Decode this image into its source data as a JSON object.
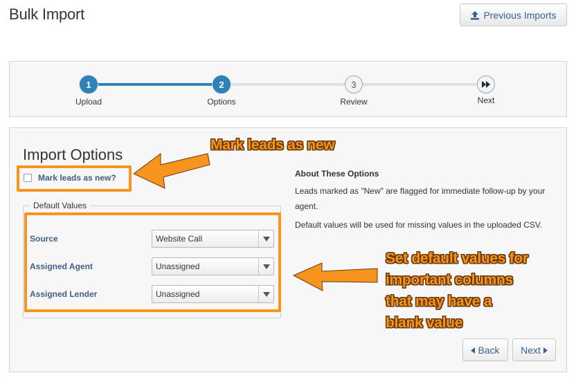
{
  "header": {
    "title": "Bulk Import",
    "previous_imports_label": "Previous Imports",
    "previous_imports_icon": "upload-icon"
  },
  "wizard": {
    "steps": [
      {
        "number": "1",
        "label": "Upload",
        "state": "complete"
      },
      {
        "number": "2",
        "label": "Options",
        "state": "current"
      },
      {
        "number": "3",
        "label": "Review",
        "state": "upcoming"
      },
      {
        "number": "",
        "label": "Next",
        "state": "upcoming",
        "icon": "fast-forward-icon"
      }
    ]
  },
  "options": {
    "title": "Import Options",
    "mark_new_label": "Mark leads as new?",
    "mark_new_checked": false,
    "defaults_legend": "Default Values",
    "fields": [
      {
        "label": "Source",
        "value": "Website Call"
      },
      {
        "label": "Assigned Agent",
        "value": "Unassigned"
      },
      {
        "label": "Assigned Lender",
        "value": "Unassigned"
      }
    ]
  },
  "about": {
    "title": "About These Options",
    "paragraph1": "Leads marked as \"New\" are flagged for immediate follow-up by your agent.",
    "paragraph2": "Default values will be used for missing values in the uploaded CSV."
  },
  "nav": {
    "back_label": "Back",
    "next_label": "Next"
  },
  "annotations": {
    "callout1": "Mark leads as new",
    "callout2_lines": [
      "Set default values for",
      "important columns",
      "that may have a",
      "blank value"
    ],
    "color": "#f7941d"
  },
  "colors": {
    "accent": "#2d82b7",
    "link": "#3e5f86"
  }
}
